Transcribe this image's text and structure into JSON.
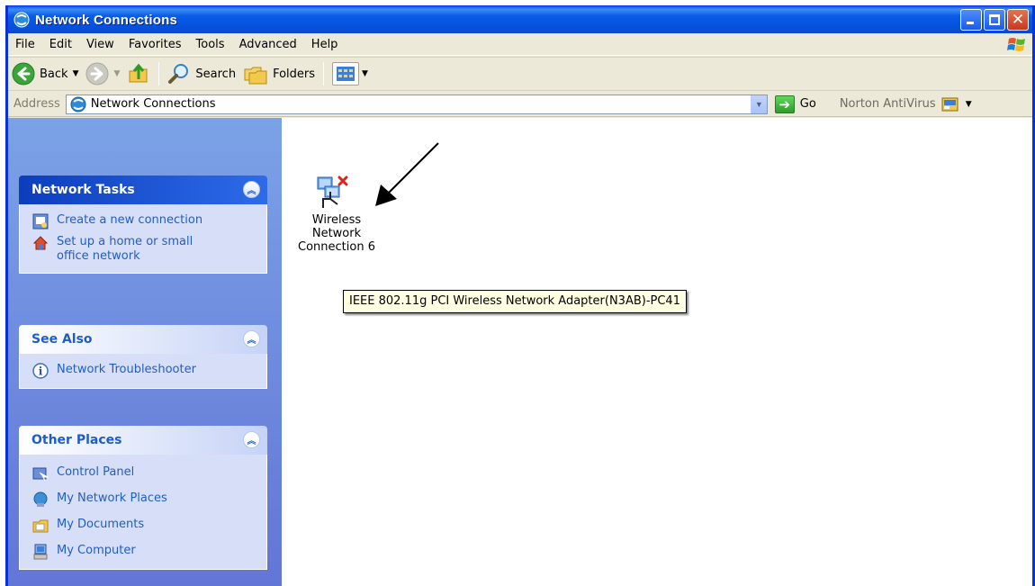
{
  "window": {
    "title": "Network Connections"
  },
  "menubar": {
    "items": [
      "File",
      "Edit",
      "View",
      "Favorites",
      "Tools",
      "Advanced",
      "Help"
    ]
  },
  "toolbar": {
    "back_label": "Back",
    "search_label": "Search",
    "folders_label": "Folders"
  },
  "address": {
    "label": "Address",
    "value": "Network Connections",
    "go_label": "Go",
    "norton_label": "Norton AntiVirus"
  },
  "taskpane": {
    "network_tasks": {
      "title": "Network Tasks",
      "items": [
        "Create a new connection",
        "Set up a home or small office network"
      ]
    },
    "see_also": {
      "title": "See Also",
      "items": [
        "Network Troubleshooter"
      ]
    },
    "other_places": {
      "title": "Other Places",
      "items": [
        "Control Panel",
        "My Network Places",
        "My Documents",
        "My Computer"
      ]
    }
  },
  "connection": {
    "name_line1": "Wireless",
    "name_line2": "Network",
    "name_line3": "Connection 6",
    "tooltip": "IEEE 802.11g PCI Wireless Network Adapter(N3AB)-PC41"
  },
  "colors": {
    "title_bar": "#0b5ce6",
    "task_link": "#215dc6",
    "task_pane_bg": "#7ba2e7",
    "tooltip_bg": "#ffffe1"
  }
}
